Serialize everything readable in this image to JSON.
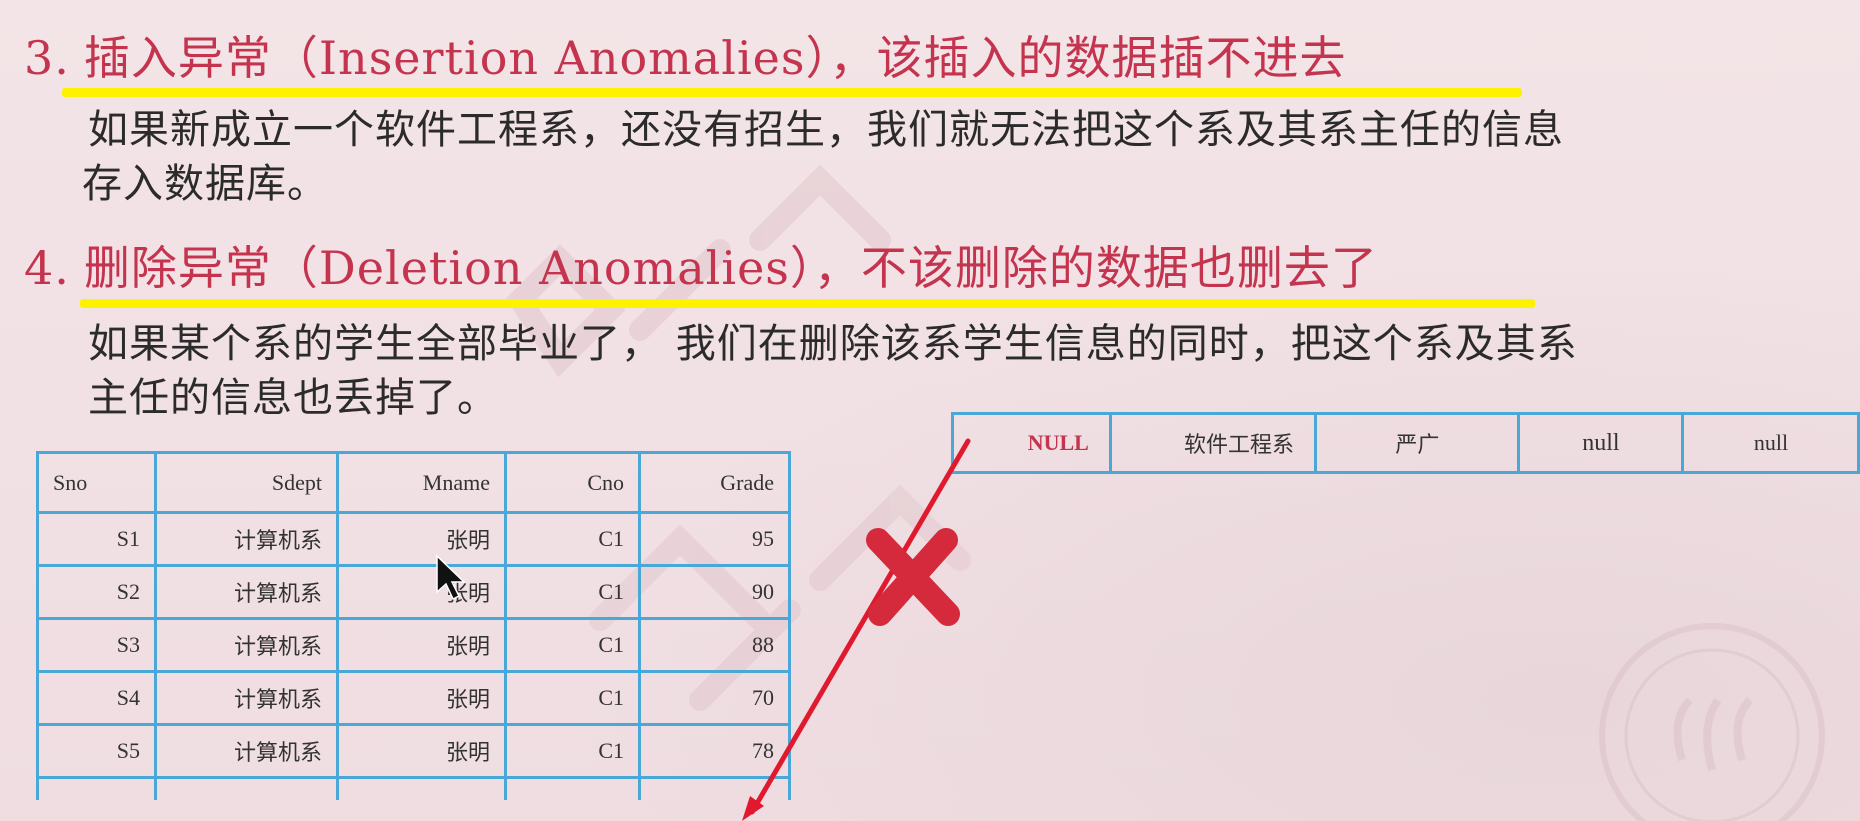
{
  "section3": {
    "number": "3.",
    "title": "插入异常（Insertion Anomalies），该插入的数据插不进去",
    "body_line1": "如果新成立一个软件工程系，还没有招生，我们就无法把这个系及其系主任的信息",
    "body_line2": "存入数据库。"
  },
  "section4": {
    "number": "4.",
    "title": "删除异常（Deletion Anomalies），不该删除的数据也删去了",
    "body_line1": "如果某个系的学生全部毕业了， 我们在删除该系学生信息的同时，把这个系及其系",
    "body_line2": "主任的信息也丢掉了。"
  },
  "table": {
    "headers": [
      "Sno",
      "Sdept",
      "Mname",
      "Cno",
      "Grade"
    ],
    "rows": [
      [
        "S1",
        "计算机系",
        "张明",
        "C1",
        "95"
      ],
      [
        "S2",
        "计算机系",
        "张明",
        "C1",
        "90"
      ],
      [
        "S3",
        "计算机系",
        "张明",
        "C1",
        "88"
      ],
      [
        "S4",
        "计算机系",
        "张明",
        "C1",
        "70"
      ],
      [
        "S5",
        "计算机系",
        "张明",
        "C1",
        "78"
      ]
    ]
  },
  "new_row": [
    "NULL",
    "软件工程系",
    "严广",
    "null",
    "null"
  ],
  "colors": {
    "heading": "#c4344e",
    "highlight": "#fff200",
    "table_border": "#4aa8d8",
    "arrow": "#e0192e",
    "cross": "#d42a3c"
  }
}
